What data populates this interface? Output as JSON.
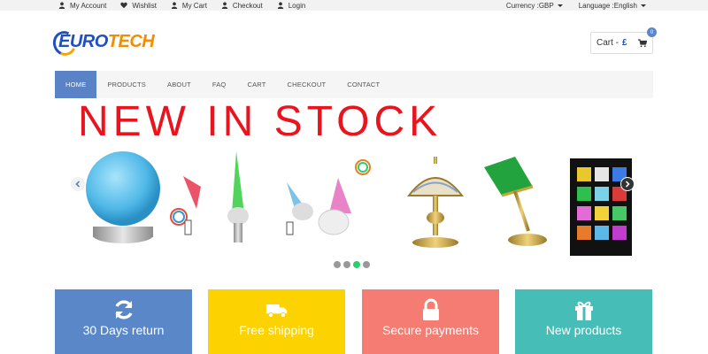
{
  "topbar": {
    "my_account": "My Account",
    "wishlist": "Wishlist",
    "my_cart": "My Cart",
    "checkout": "Checkout",
    "login": "Login",
    "currency": "Currency :GBP",
    "language": "Language :English"
  },
  "header": {
    "logo_euro": "EURO",
    "logo_tech": "TECH",
    "cart_label": "Cart -",
    "cart_currency": "£",
    "cart_count": "0"
  },
  "nav": {
    "items": [
      "HOME",
      "PRODUCTS",
      "ABOUT",
      "FAQ",
      "CART",
      "CHECKOUT",
      "CONTACT"
    ],
    "active": "HOME"
  },
  "banner": {
    "headline": "NEW IN STOCK",
    "slide_count": 4,
    "active_slide": 3
  },
  "features": [
    {
      "label": "30 Days return",
      "icon": "refresh-icon",
      "color": "#5a87c8"
    },
    {
      "label": "Free shipping",
      "icon": "truck-icon",
      "color": "#fcd200"
    },
    {
      "label": "Secure payments",
      "icon": "lock-icon",
      "color": "#f57c72"
    },
    {
      "label": "New products",
      "icon": "gift-icon",
      "color": "#47bdb8"
    }
  ]
}
